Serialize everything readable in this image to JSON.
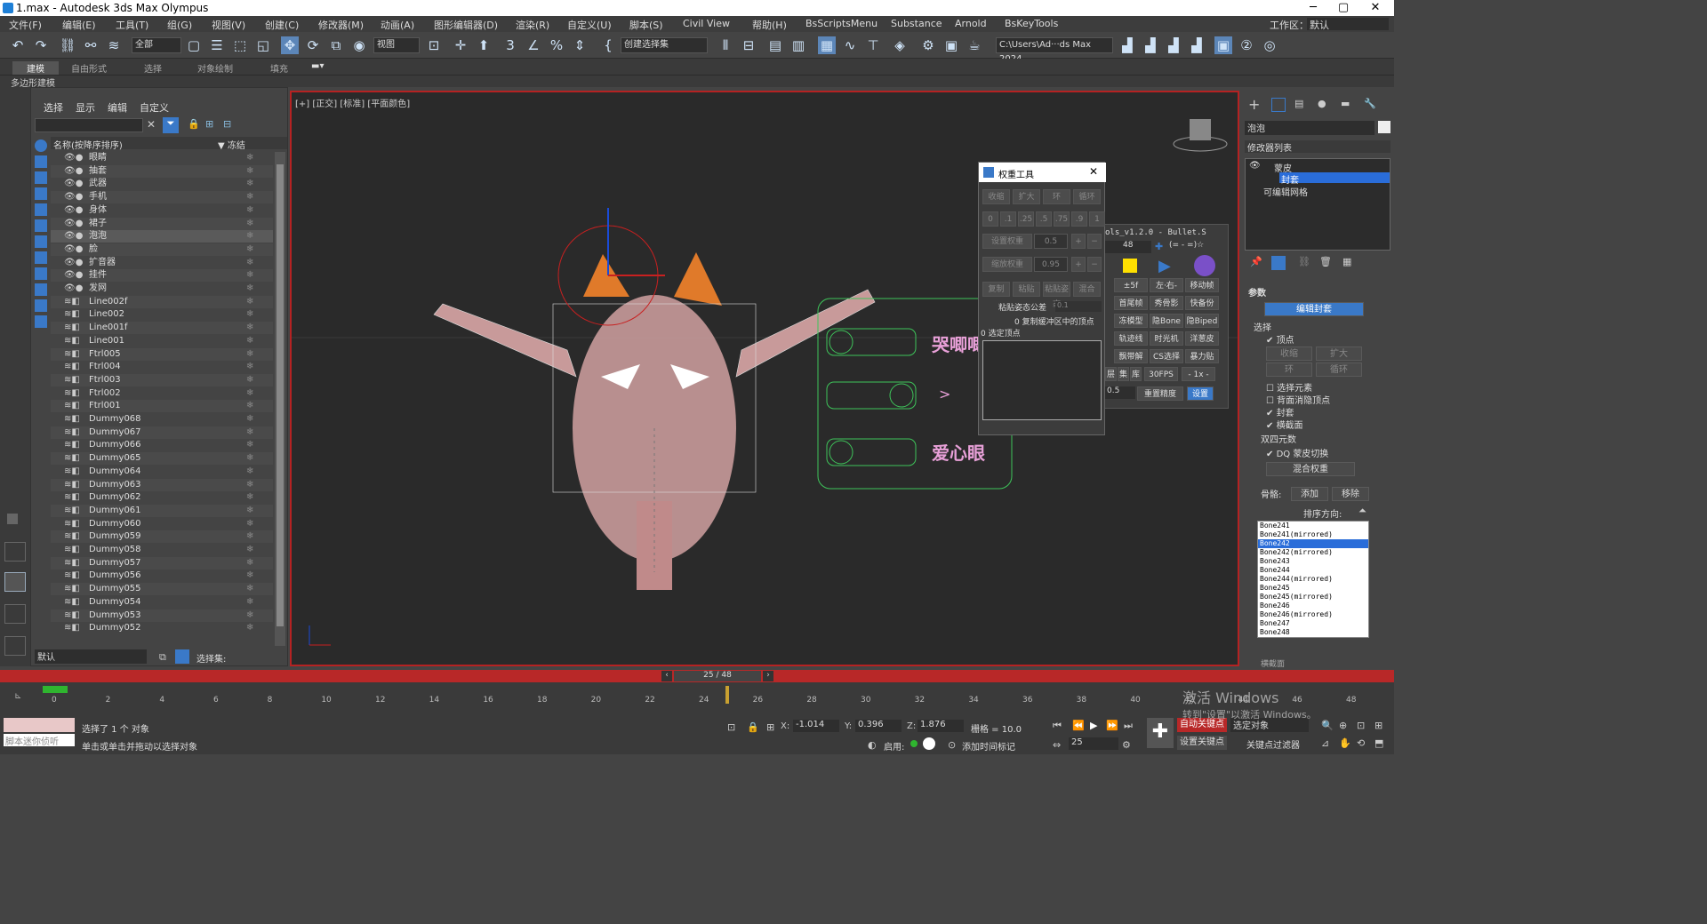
{
  "window": {
    "title": "1.max - Autodesk 3ds Max Olympus",
    "minimize": "─",
    "maximize": "▢",
    "close": "✕"
  },
  "menu": [
    "文件(F)",
    "编辑(E)",
    "工具(T)",
    "组(G)",
    "视图(V)",
    "创建(C)",
    "修改器(M)",
    "动画(A)",
    "图形编辑器(D)",
    "渲染(R)",
    "自定义(U)",
    "脚本(S)",
    "Civil View",
    "帮助(H)",
    "BsScriptsMenu",
    "Substance",
    "Arnold",
    "BsKeyTools"
  ],
  "workspace": {
    "label": "工作区：",
    "value": "默认"
  },
  "toolbar": {
    "filter": "全部",
    "refcoord": "视图",
    "selset": "创建选择集",
    "path": "C:\\Users\\Ad···ds Max 2024"
  },
  "ribbon": {
    "tabs": [
      "建模",
      "自由形式",
      "选择",
      "对象绘制",
      "填充"
    ],
    "sub": "多边形建模"
  },
  "scene_explorer": {
    "menu": [
      "选择",
      "显示",
      "编辑",
      "自定义"
    ],
    "col_name": "名称(按降序排序)",
    "col_freeze": "▼ 冻结",
    "rows": [
      "眼睛",
      "抽套",
      "武器",
      "手机",
      "身体",
      "裙子",
      "泡泡",
      "脸",
      "扩音器",
      "挂件",
      "发网",
      "Line002f",
      "Line002",
      "Line001f",
      "Line001",
      "Ftrl005",
      "Ftrl004",
      "Ftrl003",
      "Ftrl002",
      "Ftrl001",
      "Dummy068",
      "Dummy067",
      "Dummy066",
      "Dummy065",
      "Dummy064",
      "Dummy063",
      "Dummy062",
      "Dummy061",
      "Dummy060",
      "Dummy059",
      "Dummy058",
      "Dummy057",
      "Dummy056",
      "Dummy055",
      "Dummy054",
      "Dummy053",
      "Dummy052"
    ],
    "selected_row": "泡泡",
    "layer": "默认",
    "selset_label": "选择集:"
  },
  "viewport": {
    "label": "[+] [正交] [标准] [平面颜色]",
    "panel_labels": [
      "哭唧唧",
      "爱心眼"
    ],
    "arrow": ">"
  },
  "weight_tool": {
    "title": "权重工具",
    "row1": [
      "收缩",
      "扩大",
      "环",
      "循环"
    ],
    "row2": [
      "0",
      ".1",
      ".25",
      ".5",
      ".75",
      ".9",
      "1"
    ],
    "set_weight": "设置权重",
    "set_val": "0.5",
    "scale_weight": "缩放权重",
    "scale_val": "0.95",
    "row3": [
      "复制",
      "粘贴",
      "粘贴姿态",
      "混合"
    ],
    "tol_label": "粘贴姿态公差",
    "tol_val": "0.1",
    "copy_info": "0  复制缓冲区中的顶点",
    "sel_info": "0  选定顶点"
  },
  "bstools": {
    "title": "ols_v1.2.0 - Bullet.S",
    "frames": "48",
    "extra": "(= - =)☆",
    "buttons": [
      "±5f",
      "左·右-",
      "移动帧",
      "首尾帧",
      "秀骨影",
      "快备份",
      "冻模型",
      "隐Bone",
      "隐Biped",
      "轨迹线",
      "时光机",
      "洋葱皮",
      "飘带解",
      "CS选择",
      "暴力贴",
      "层",
      "集",
      "库",
      "30FPS",
      "- 1x -"
    ],
    "fps_val": "0.5",
    "reset_btn": "重置精度",
    "set_btn": "设置"
  },
  "command_panel": {
    "obj_name": "泡泡",
    "modlist": "修改器列表",
    "stack": [
      "蒙皮",
      "封套",
      "可编辑网格"
    ],
    "params": "参数",
    "edit_env": "编辑封套",
    "select": "选择",
    "chk_vertex": "顶点",
    "shrink": "收缩",
    "grow": "扩大",
    "ring": "环",
    "loop": "循环",
    "chk_selel": "选择元素",
    "chk_backface": "背面消隐顶点",
    "chk_env": "封套",
    "chk_cross": "横截面",
    "dq": "双四元数",
    "dq_toggle": "DQ 蒙皮切换",
    "blend": "混合权重",
    "bones_label": "骨骼:",
    "add": "添加",
    "remove": "移除",
    "sort": "排序方向:",
    "bones": [
      "Bone241",
      "Bone241(mirrored)",
      "Bone242",
      "Bone242(mirrored)",
      "Bone243",
      "Bone244",
      "Bone244(mirrored)",
      "Bone245",
      "Bone245(mirrored)",
      "Bone246",
      "Bone246(mirrored)",
      "Bone247",
      "Bone248"
    ],
    "selected_bone": "Bone242",
    "cross": "横截面"
  },
  "timeline": {
    "frame": "25 / 48",
    "ticks": [
      "0",
      "2",
      "4",
      "6",
      "8",
      "10",
      "12",
      "14",
      "16",
      "18",
      "20",
      "22",
      "24",
      "26",
      "28",
      "30",
      "32",
      "34",
      "36",
      "38",
      "40",
      "42",
      "44",
      "46",
      "48"
    ]
  },
  "status": {
    "selected": "选择了 1 个 对象",
    "hint": "单击或单击并拖动以选择对象",
    "script": "脚本迷你侦听",
    "x": "-1.014",
    "y": "0.396",
    "z": "1.876",
    "grid": "栅格 = 10.0",
    "enable": "启用:",
    "addtime": "添加时间标记",
    "autokey": "自动关键点",
    "setkey": "设置关键点",
    "keyfilter": "关键点过滤器",
    "selobj": "选定对象",
    "frame": "25",
    "watermark1": "激活 Windows",
    "watermark2": "转到\"设置\"以激活 Windows。"
  },
  "colors": {
    "accent": "#b82828",
    "blue": "#3a79c8",
    "panel_green": "#3ec45a"
  }
}
